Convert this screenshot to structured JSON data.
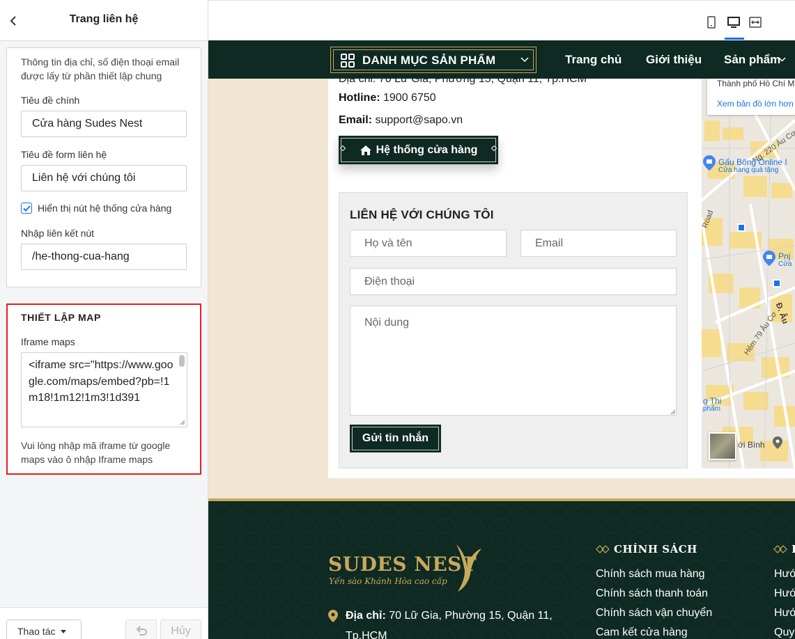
{
  "panel": {
    "title": "Trang liên hệ",
    "info_hint": "Thông tin địa chỉ, số điện thoại email được lấy từ phần thiết lập chung",
    "main_title_label": "Tiêu đề chính",
    "main_title_value": "Cửa hàng Sudes Nest",
    "form_title_label": "Tiêu đề form liên hệ",
    "form_title_value": "Liên hệ với chúng tôi",
    "show_store_button_label": "Hiển thị nút hệ thống cửa hàng",
    "show_store_button_checked": true,
    "button_link_label": "Nhập liên kết nút",
    "button_link_value": "/he-thong-cua-hang",
    "map_section": {
      "heading": "THIẾT LẬP MAP",
      "iframe_label": "Iframe maps",
      "iframe_value": "<iframe src=\"https://www.google.com/maps/embed?pb=!1m18!1m12!1m3!1d391",
      "help_text": "Vui lòng nhập mã iframe từ google maps vào ô nhập Iframe maps"
    },
    "footer": {
      "actions_label": "Thao tác",
      "cancel_label": "Hủy"
    }
  },
  "preview": {
    "devices": [
      "mobile-icon",
      "desktop-icon",
      "fullwidth-icon"
    ],
    "active_device": "desktop",
    "nav": {
      "category_label": "DANH MỤC SẢN PHẨM",
      "links": [
        "Trang chủ",
        "Giới thiệu",
        "Sản phẩm"
      ]
    },
    "contact": {
      "address_partial": "Địa chỉ: 70 Lữ Gia, Phường 15, Quận 11, Tp.HCM",
      "hotline_label": "Hotline:",
      "hotline_value": "1900 6750",
      "email_label": "Email:",
      "email_value": "support@sapo.vn",
      "store_button": "Hệ thống cửa hàng"
    },
    "form": {
      "title": "LIÊN HỆ VỚI CHÚNG TÔI",
      "name_placeholder": "Họ và tên",
      "email_placeholder": "Email",
      "phone_placeholder": "Điện thoại",
      "message_placeholder": "Nội dung",
      "submit": "Gửi tin nhắn"
    },
    "map": {
      "city": "Thành phố Hồ Chí Mi",
      "large_map_link": "Xem bản đồ lớn hơn",
      "labels": [
        "Ng. 220 Âu Cơ",
        "Gấu Bông Online I",
        "Cửa hàng quà tặng",
        "Road",
        "Pnj",
        "Cửa",
        "Đ. Âu",
        "Hẻm 79 Âu Cơ",
        "g Thi",
        "phẩm",
        "ới Bình"
      ]
    },
    "footer": {
      "logo_name": "SUDES NEST",
      "logo_tagline": "Yến sào Khánh Hòa cao cấp",
      "address_label": "Địa chỉ:",
      "address_value": "70 Lữ Gia, Phường 15, Quận 11, Tp.HCM",
      "policy_heading": "CHÍNH SÁCH",
      "policy_links": [
        "Chính sách mua hàng",
        "Chính sách thanh toán",
        "Chính sách vận chuyển",
        "Cam kết cửa hàng"
      ],
      "second_heading": "H",
      "second_links": [
        "Hướ",
        "Hướ",
        "Hướ",
        "Quy"
      ]
    },
    "colors": {
      "brand_dark": "#0e2a22",
      "brand_gold": "#c9a85c",
      "page_bg": "#f0e6d2",
      "highlight_red": "#e0211b",
      "accent_blue": "#1a73e8"
    }
  }
}
